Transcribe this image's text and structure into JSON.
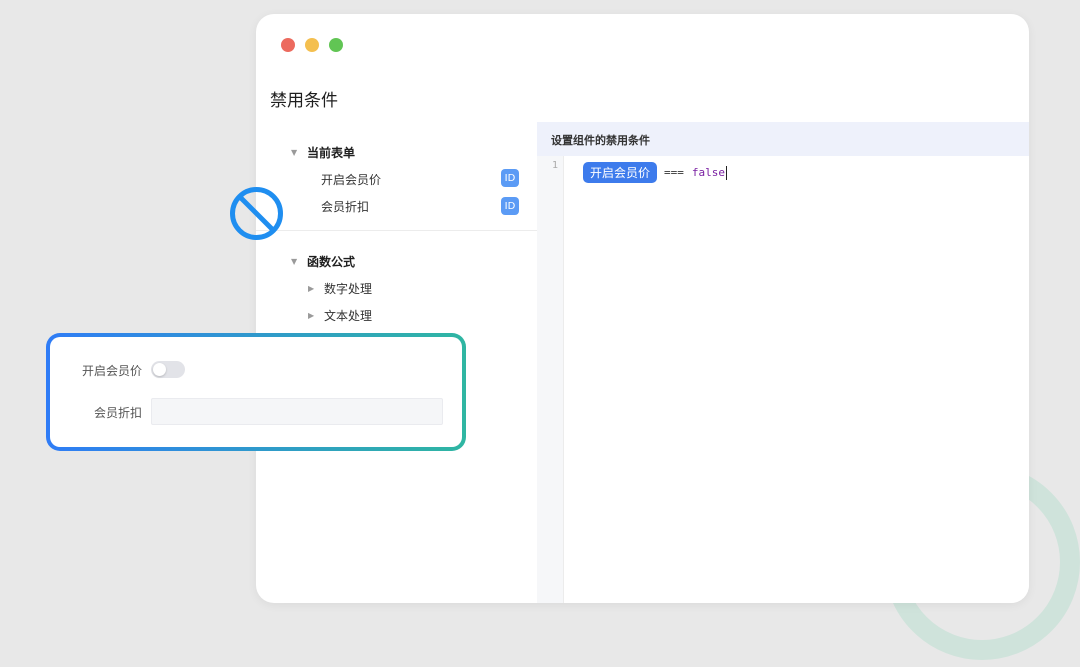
{
  "window": {
    "title": "禁用条件"
  },
  "tree": {
    "current_form": {
      "label": "当前表单",
      "items": [
        {
          "label": "开启会员价",
          "badge": "ID"
        },
        {
          "label": "会员折扣",
          "badge": "ID"
        }
      ]
    },
    "functions": {
      "label": "函数公式",
      "items": [
        {
          "label": "数字处理"
        },
        {
          "label": "文本处理"
        }
      ]
    }
  },
  "editor": {
    "header": "设置组件的禁用条件",
    "line_number": "1",
    "field_tag": "开启会员价",
    "operator": "===",
    "value": "false"
  },
  "preview": {
    "toggle_label": "开启会员价",
    "toggle_on": false,
    "input_label": "会员折扣",
    "input_value": ""
  },
  "icons": {
    "disable": "prohibited-icon"
  },
  "colors": {
    "accent": "#3d7bec",
    "keyword": "#7a1fa2",
    "gradient_start": "#2f7cf6",
    "gradient_end": "#2fb6a2"
  }
}
